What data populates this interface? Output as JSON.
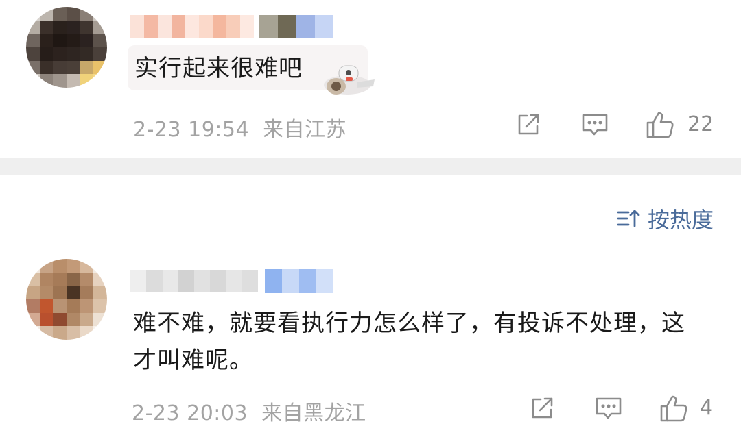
{
  "comments": [
    {
      "text": "实行起来很难吧",
      "date": "2-23 19:54",
      "location": "来自江苏",
      "likes": "22",
      "icons": [
        "share-icon",
        "comment-icon",
        "thumbs-up-icon"
      ]
    },
    {
      "text_line1": "难不难，就要看执行力怎么样了，有投诉不处理，这",
      "text_line2": "才叫难呢。",
      "date": "2-23 20:03",
      "location": "来自黑龙江",
      "likes": "4",
      "icons": [
        "share-icon",
        "comment-icon",
        "thumbs-up-icon"
      ]
    }
  ],
  "sort": {
    "label": "按热度",
    "icon": "sort-icon"
  },
  "colors": {
    "meta": "#a3a3a3",
    "sort": "#4a6b9a",
    "divider": "#efefef",
    "badge": "#8fb3f0"
  }
}
